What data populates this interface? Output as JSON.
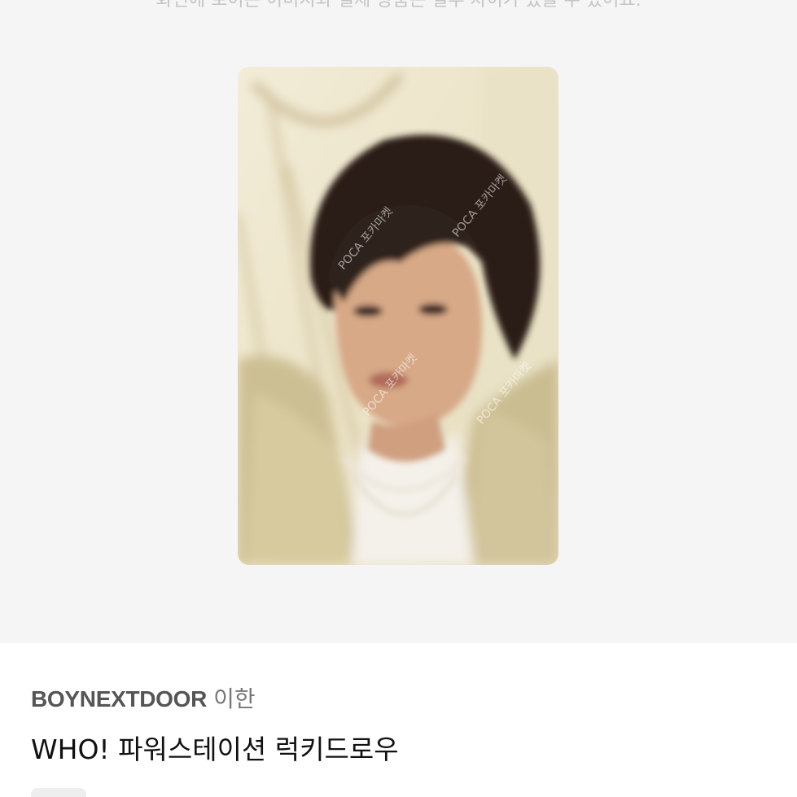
{
  "gallery": {
    "notice": "화면에 보이는 이미지와 실제 상품은 일부 차이가 있을 수 있어요.",
    "watermark": "POCA 포카마켓"
  },
  "product": {
    "group": "BOYNEXTDOOR",
    "member": "이한",
    "title": "WHO! 파워스테이션 럭키드로우"
  }
}
